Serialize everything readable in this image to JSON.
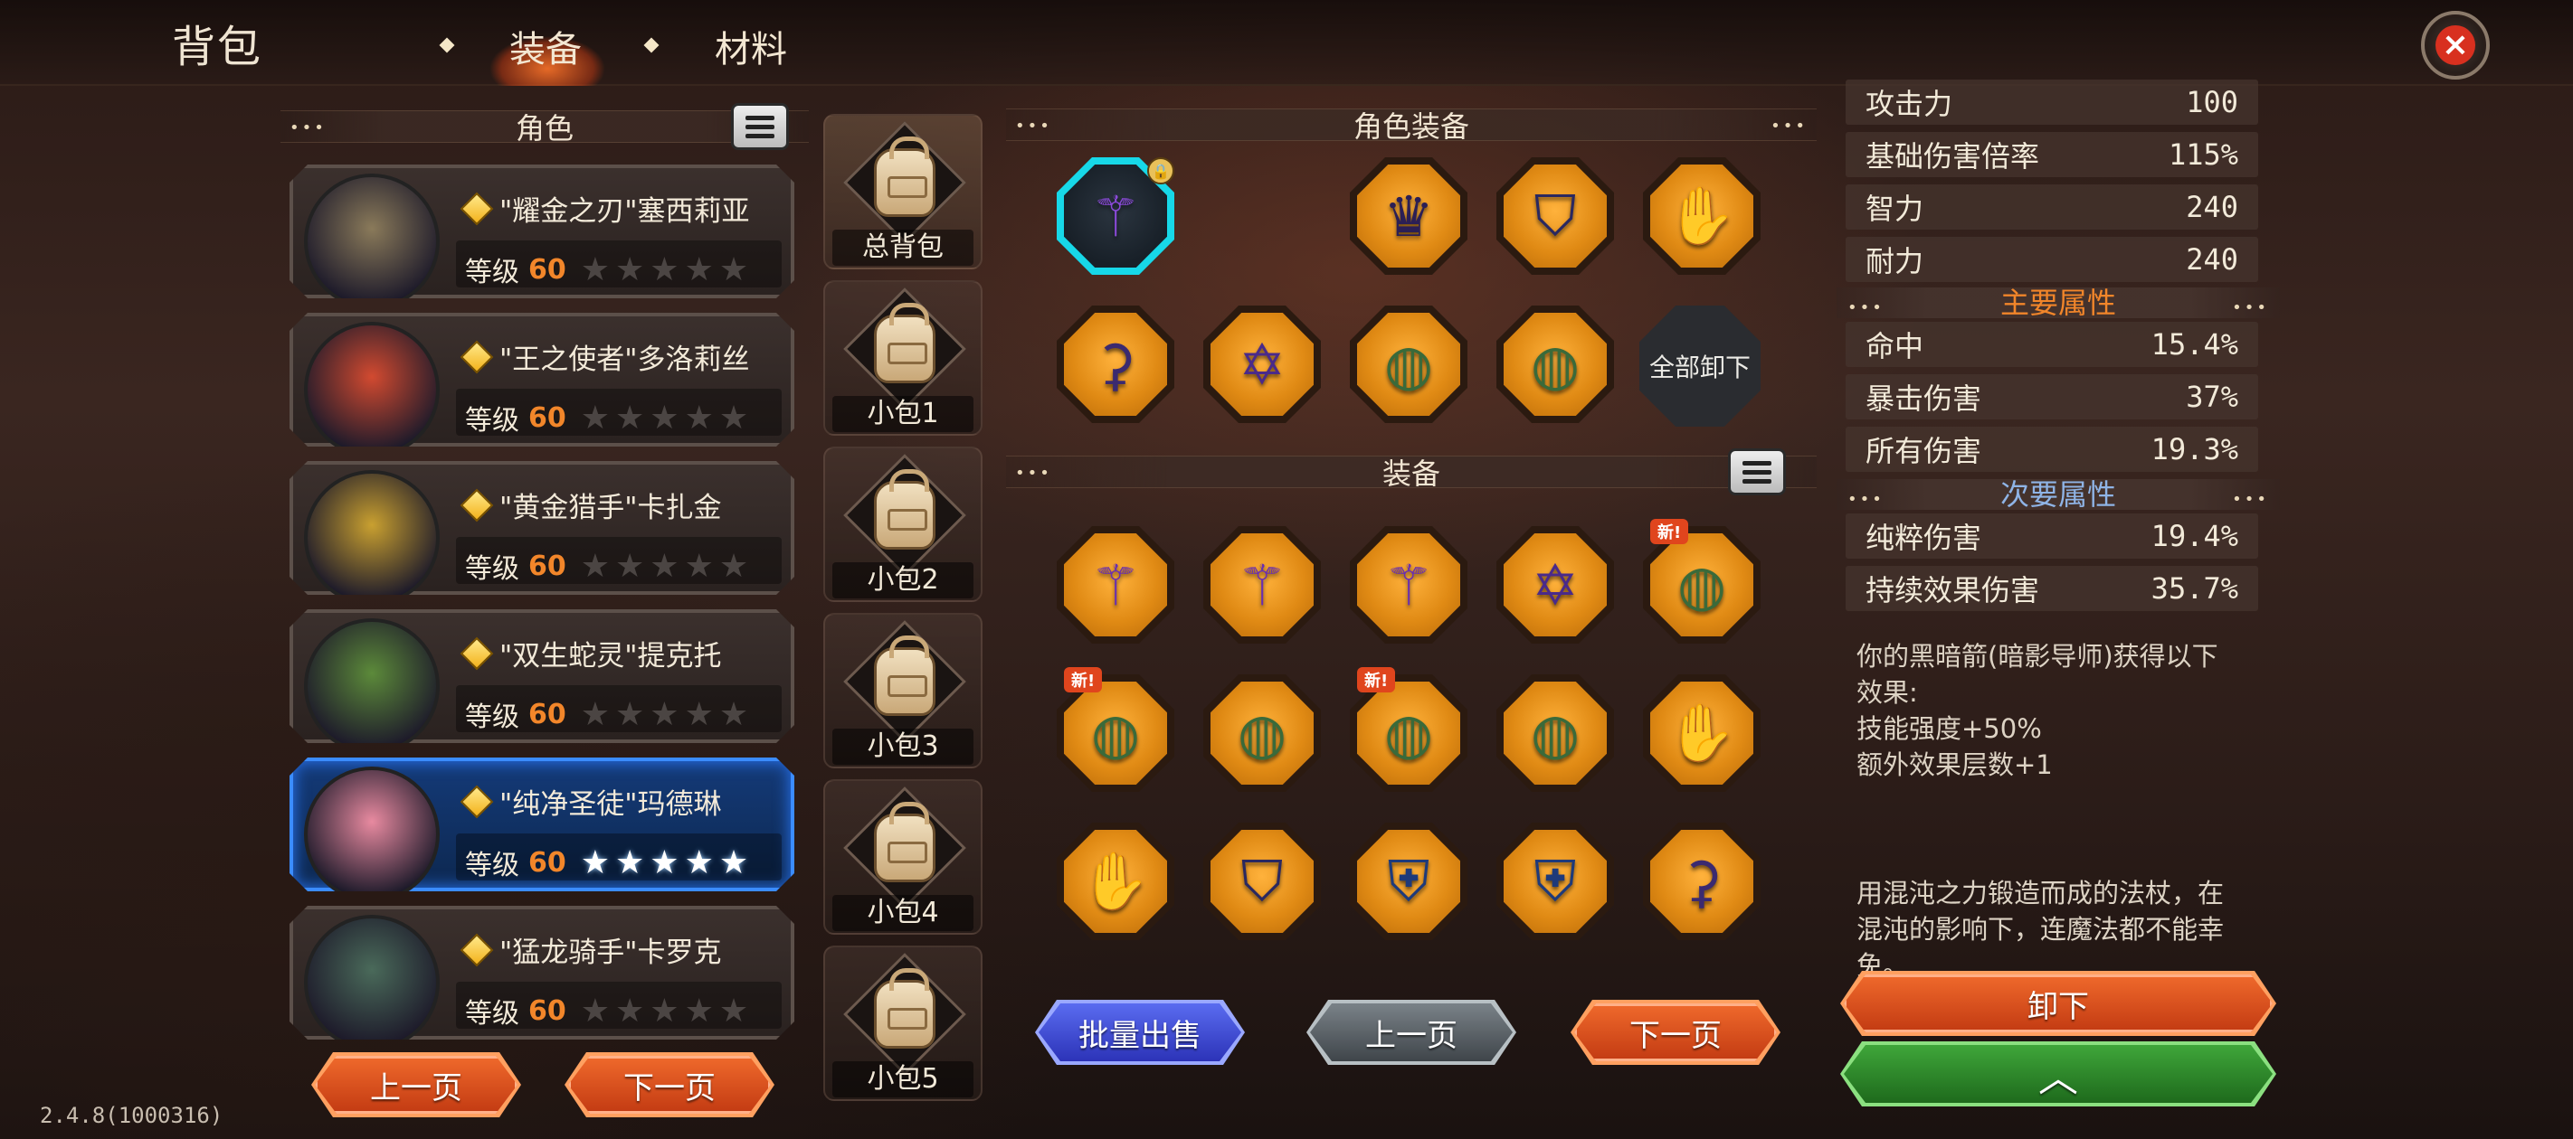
{
  "header": {
    "title": "背包",
    "tabs": [
      {
        "label": "装备",
        "active": true
      },
      {
        "label": "材料",
        "active": false
      }
    ],
    "close_icon": "close-icon"
  },
  "characters": {
    "section_title": "角色",
    "level_label": "等级",
    "items": [
      {
        "name": "\"耀金之刃\"塞西莉亚",
        "level": "60",
        "stars": "★★★★★",
        "selected": false
      },
      {
        "name": "\"王之使者\"多洛莉丝",
        "level": "60",
        "stars": "★★★★★",
        "selected": false
      },
      {
        "name": "\"黄金猎手\"卡扎金",
        "level": "60",
        "stars": "★★★★★",
        "selected": false
      },
      {
        "name": "\"双生蛇灵\"提克托",
        "level": "60",
        "stars": "★★★★★",
        "selected": false
      },
      {
        "name": "\"纯净圣徒\"玛德琳",
        "level": "60",
        "stars": "★★★★★",
        "selected": true
      },
      {
        "name": "\"猛龙骑手\"卡罗克",
        "level": "60",
        "stars": "★★★★★",
        "selected": false
      }
    ],
    "prev_page": "上一页",
    "next_page": "下一页"
  },
  "bags": [
    {
      "label": "总背包"
    },
    {
      "label": "小包1"
    },
    {
      "label": "小包2"
    },
    {
      "label": "小包3"
    },
    {
      "label": "小包4"
    },
    {
      "label": "小包5"
    }
  ],
  "character_equipment": {
    "section_title": "角色装备",
    "unequip_all": "全部卸下",
    "slots": [
      {
        "icon": "staff-icon",
        "selected": true,
        "locked": true
      },
      {
        "icon": "empty-slot"
      },
      {
        "icon": "crown-icon"
      },
      {
        "icon": "robe-icon"
      },
      {
        "icon": "gloves-icon"
      },
      {
        "icon": "boots-icon"
      },
      {
        "icon": "star-amulet-icon"
      },
      {
        "icon": "ring-icon"
      },
      {
        "icon": "ring-icon"
      }
    ]
  },
  "inventory": {
    "section_title": "装备",
    "new_badge": "新!",
    "items": [
      {
        "icon": "staff-icon",
        "is_new": false
      },
      {
        "icon": "staff-icon",
        "is_new": false
      },
      {
        "icon": "staff-icon",
        "is_new": false
      },
      {
        "icon": "star-amulet-icon",
        "is_new": false
      },
      {
        "icon": "ring-icon",
        "is_new": true
      },
      {
        "icon": "ring-icon",
        "is_new": true
      },
      {
        "icon": "ring-icon",
        "is_new": false
      },
      {
        "icon": "ring-icon",
        "is_new": true
      },
      {
        "icon": "ring-icon",
        "is_new": false
      },
      {
        "icon": "gloves-icon",
        "is_new": false
      },
      {
        "icon": "gloves-icon",
        "is_new": false
      },
      {
        "icon": "robe-icon",
        "is_new": false
      },
      {
        "icon": "armor-icon",
        "is_new": false
      },
      {
        "icon": "armor-icon",
        "is_new": false
      },
      {
        "icon": "boots-icon",
        "is_new": false
      }
    ],
    "bulk_sell": "批量出售",
    "prev_page": "上一页",
    "next_page": "下一页"
  },
  "stats": {
    "top": [
      {
        "label": "攻击力",
        "value": "100"
      },
      {
        "label": "基础伤害倍率",
        "value": "115%"
      },
      {
        "label": "智力",
        "value": "240"
      },
      {
        "label": "耐力",
        "value": "240"
      }
    ],
    "primary_title": "主要属性",
    "primary": [
      {
        "label": "命中",
        "value": "15.4%"
      },
      {
        "label": "暴击伤害",
        "value": "37%"
      },
      {
        "label": "所有伤害",
        "value": "19.3%"
      }
    ],
    "secondary_title": "次要属性",
    "secondary": [
      {
        "label": "纯粹伤害",
        "value": "19.4%"
      },
      {
        "label": "持续效果伤害",
        "value": "35.7%"
      }
    ],
    "effect_lines": [
      "你的黑暗箭(暗影导师)获得以下",
      "效果:",
      "技能强度+50%",
      "额外效果层数+1"
    ],
    "flavor_lines": [
      "用混沌之力锻造而成的法杖，在",
      "混沌的影响下，连魔法都不能幸",
      "免。"
    ],
    "unequip_button": "卸下"
  },
  "version": "2.4.8(1000316)",
  "colors": {
    "accent_orange": "#f2862a",
    "selected_blue": "#3b8cff",
    "slot_gold": "#e08a14",
    "close_red": "#d8301f",
    "primary_title": "#f2862a",
    "secondary_title": "#8fb4e6"
  }
}
